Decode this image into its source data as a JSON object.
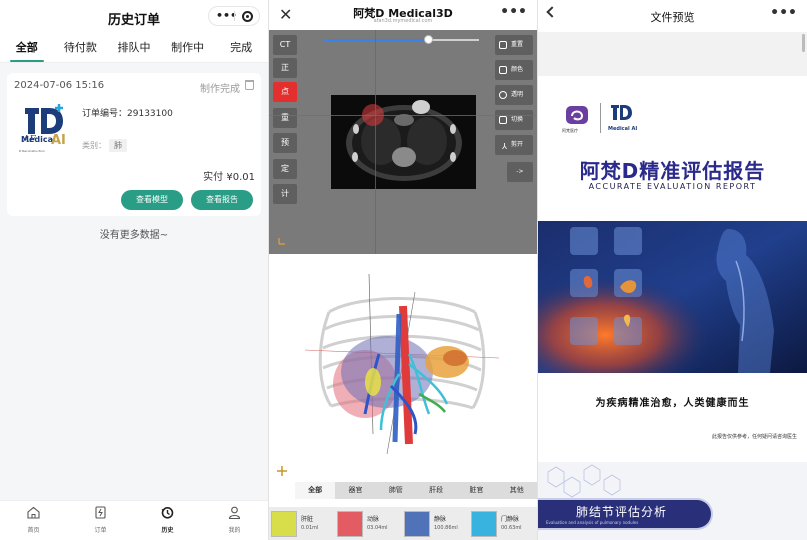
{
  "order_list": {
    "title": "历史订单",
    "capsule_dots": "•••",
    "tabs": [
      "全部",
      "待付款",
      "排队中",
      "制作中",
      "完成"
    ],
    "active_tab": 0,
    "order": {
      "datetime": "2024-07-06 15:16",
      "status": "制作完成",
      "logo_text": "Medical",
      "logo_ai": "AI",
      "logo_sub": "D Reconstruction",
      "order_no_label": "订单编号：",
      "order_no": "29133100",
      "type_label": "类别：",
      "type_value": "肺",
      "paid_label": "实付",
      "paid_value": "¥0.01",
      "btn_model": "查看模型",
      "btn_report": "查看报告"
    },
    "no_more": "没有更多数据~",
    "nav": [
      "首页",
      "订单",
      "历史",
      "我的"
    ],
    "nav_active": 2
  },
  "viewer": {
    "title": "阿梵D Medical3D",
    "url": "afan3d.mymedical.com",
    "more": "•••",
    "left_buttons": [
      "CT",
      "正",
      "点",
      "重",
      "预",
      "定",
      "计"
    ],
    "left_active": 2,
    "right_buttons": [
      "重置",
      "颜色",
      "透明",
      "切换",
      "剪开",
      "->"
    ],
    "slice_level": 0.67,
    "segments": [
      "全部",
      "器官",
      "肺管",
      "肝段",
      "脏官",
      "其他"
    ],
    "segment_active": 0,
    "organs": [
      {
        "name": "肝脏",
        "volume": "0.01ml",
        "color": "#d8de4a"
      },
      {
        "name": "动脉",
        "volume": "03.04ml",
        "color": "#e35c63"
      },
      {
        "name": "静脉",
        "volume": "100.86ml",
        "color": "#4f72b8"
      },
      {
        "name": "门静脉",
        "volume": "00.63ml",
        "color": "#38b3e0"
      }
    ]
  },
  "preview": {
    "title": "文件预览",
    "more": "•••",
    "report_title": "阿梵D精准评估报告",
    "report_subtitle": "ACCURATE EVALUATION REPORT",
    "logo_left": "阿梵医疗",
    "logo_right": "Medical AI",
    "slogan": "为疾病精准治愈，人类健康而生",
    "note": "此报告仅供参考，任何疑问请咨询医生",
    "banner_title": "肺结节评估分析",
    "banner_sub": "Evaluation and analysis of pulmonary nodules"
  }
}
